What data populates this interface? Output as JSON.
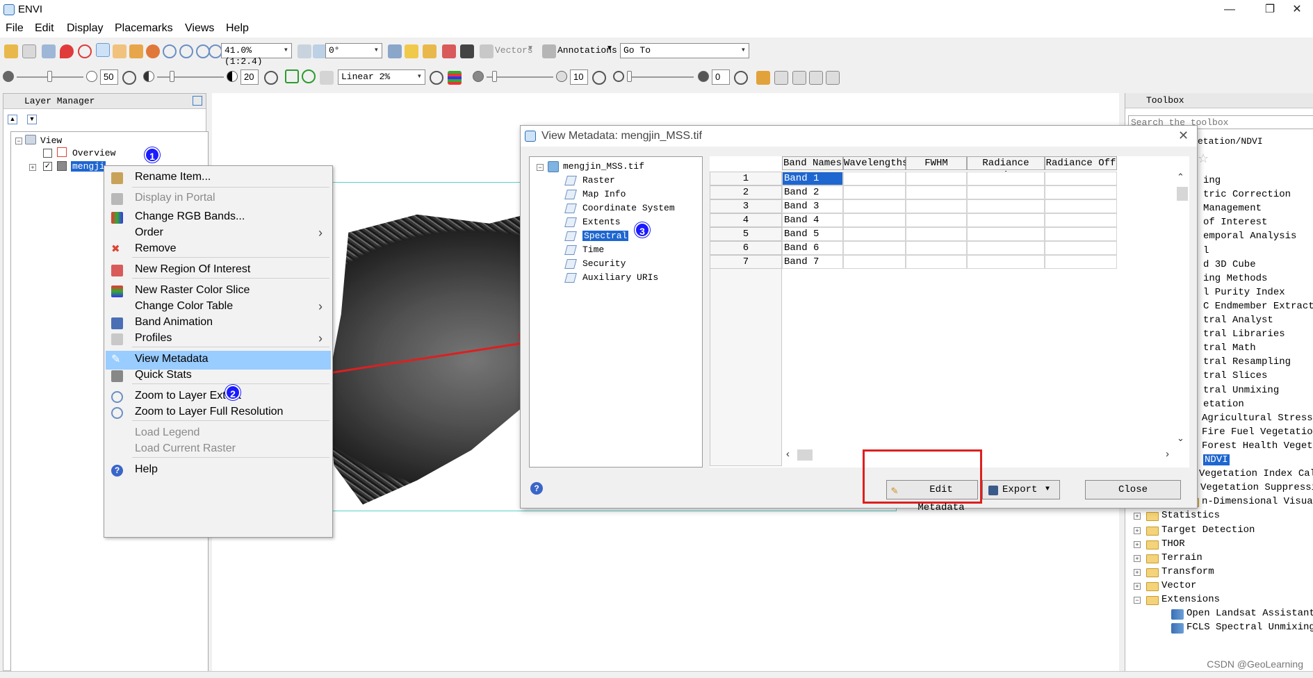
{
  "window": {
    "title": "ENVI",
    "minimize": "—",
    "restore": "❐",
    "close": "✕"
  },
  "menu": [
    "File",
    "Edit",
    "Display",
    "Placemarks",
    "Views",
    "Help"
  ],
  "toolbar1": {
    "zoom": "41.0% (1:2.4)",
    "rotation": "0°",
    "vectors": "Vectors",
    "annotations": "Annotations",
    "goto": "Go To"
  },
  "toolbar2": {
    "brightness": "50",
    "contrast": "20",
    "stretch": "Linear 2%",
    "sharpen": "10",
    "transparency": "0"
  },
  "layer_manager": {
    "title": "Layer Manager",
    "tree": [
      "View",
      "Overview",
      "mengjin_MSS.tif"
    ]
  },
  "context_menu": {
    "items": [
      {
        "label": "Rename Item...",
        "icon": "rename-icon",
        "disabled": false
      },
      {
        "label": "Display in Portal",
        "icon": "portal-icon",
        "disabled": true
      },
      {
        "label": "Change RGB Bands...",
        "icon": "rgb-icon",
        "disabled": false
      },
      {
        "label": "Order",
        "icon": "",
        "disabled": false,
        "submenu": true
      },
      {
        "label": "Remove",
        "icon": "remove-icon",
        "disabled": false
      },
      {
        "label": "New Region Of Interest",
        "icon": "roi-icon",
        "disabled": false
      },
      {
        "label": "New Raster Color Slice",
        "icon": "color-slice-icon",
        "disabled": false
      },
      {
        "label": "Change Color Table",
        "icon": "",
        "disabled": false,
        "submenu": true
      },
      {
        "label": "Band Animation",
        "icon": "animation-icon",
        "disabled": false
      },
      {
        "label": "Profiles",
        "icon": "profiles-icon",
        "disabled": false,
        "submenu": true
      },
      {
        "label": "View Metadata",
        "icon": "metadata-icon",
        "disabled": false,
        "selected": true
      },
      {
        "label": "Quick Stats",
        "icon": "stats-icon",
        "disabled": false
      },
      {
        "label": "Zoom to Layer Extent",
        "icon": "zoom-extent-icon",
        "disabled": false
      },
      {
        "label": "Zoom to Layer Full Resolution",
        "icon": "zoom-full-icon",
        "disabled": false
      },
      {
        "label": "Load Legend",
        "icon": "",
        "disabled": true
      },
      {
        "label": "Load Current Raster",
        "icon": "",
        "disabled": true
      },
      {
        "label": "Help",
        "icon": "help-icon",
        "disabled": false
      }
    ]
  },
  "badges": [
    "1",
    "2",
    "3"
  ],
  "metadata_dialog": {
    "title": "View Metadata: mengjin_MSS.tif",
    "tree_root": "mengjin_MSS.tif",
    "tree_items": [
      "Raster",
      "Map Info",
      "Coordinate System",
      "Extents",
      "Spectral",
      "Time",
      "Security",
      "Auxiliary URIs"
    ],
    "columns": [
      "Band Names",
      "Wavelengths",
      "FWHM",
      "Radiance Gains",
      "Radiance Off"
    ],
    "rows": [
      {
        "num": "1",
        "band": "Band 1"
      },
      {
        "num": "2",
        "band": "Band 2"
      },
      {
        "num": "3",
        "band": "Band 3"
      },
      {
        "num": "4",
        "band": "Band 4"
      },
      {
        "num": "5",
        "band": "Band 5"
      },
      {
        "num": "6",
        "band": "Band 6"
      },
      {
        "num": "7",
        "band": "Band 7"
      }
    ],
    "edit_button": "Edit Metadata",
    "export_button": "Export",
    "close_button": "Close"
  },
  "toolbox": {
    "title": "Toolbox",
    "search_placeholder": "Search the toolbox",
    "path": "etation/NDVI",
    "items": [
      {
        "label": "ing",
        "indent": 2,
        "kind": "text"
      },
      {
        "label": "tric Correction",
        "indent": 2,
        "kind": "text"
      },
      {
        "label": "Management",
        "indent": 2,
        "kind": "text"
      },
      {
        "label": "of Interest",
        "indent": 2,
        "kind": "text"
      },
      {
        "label": "emporal Analysis",
        "indent": 2,
        "kind": "text"
      },
      {
        "label": "l",
        "indent": 2,
        "kind": "text"
      },
      {
        "label": "d 3D Cube",
        "indent": 2,
        "kind": "text"
      },
      {
        "label": "ing Methods",
        "indent": 2,
        "kind": "text"
      },
      {
        "label": "l Purity Index",
        "indent": 2,
        "kind": "text"
      },
      {
        "label": "C Endmember Extraction",
        "indent": 2,
        "kind": "text"
      },
      {
        "label": "tral Analyst",
        "indent": 2,
        "kind": "text"
      },
      {
        "label": "tral Libraries",
        "indent": 2,
        "kind": "text"
      },
      {
        "label": "tral Math",
        "indent": 2,
        "kind": "text"
      },
      {
        "label": "tral Resampling",
        "indent": 2,
        "kind": "text"
      },
      {
        "label": "tral Slices",
        "indent": 2,
        "kind": "text"
      },
      {
        "label": "tral Unmixing",
        "indent": 2,
        "kind": "text"
      },
      {
        "label": "etation",
        "indent": 2,
        "kind": "text"
      },
      {
        "label": "Agricultural Stress Ve",
        "indent": 2,
        "kind": "text"
      },
      {
        "label": "Fire Fuel Vegetation A",
        "indent": 2,
        "kind": "text"
      },
      {
        "label": "Forest Health Vegetati",
        "indent": 2,
        "kind": "text"
      },
      {
        "label": "NDVI",
        "indent": 2,
        "kind": "selected"
      },
      {
        "label": "Vegetation Index Calcu",
        "indent": 2,
        "kind": "text"
      },
      {
        "label": "Vegetation Suppression",
        "indent": 2,
        "kind": "tool"
      },
      {
        "label": "n-Dimensional Visualizer",
        "indent": 1,
        "kind": "folder"
      },
      {
        "label": "Statistics",
        "indent": 0,
        "kind": "folder"
      },
      {
        "label": "Target Detection",
        "indent": 0,
        "kind": "folder"
      },
      {
        "label": "THOR",
        "indent": 0,
        "kind": "folder"
      },
      {
        "label": "Terrain",
        "indent": 0,
        "kind": "folder"
      },
      {
        "label": "Transform",
        "indent": 0,
        "kind": "folder"
      },
      {
        "label": "Vector",
        "indent": 0,
        "kind": "folder"
      },
      {
        "label": "Extensions",
        "indent": 0,
        "kind": "folder-open"
      },
      {
        "label": "Open Landsat Assistant",
        "indent": 1,
        "kind": "tool"
      },
      {
        "label": "FCLS Spectral Unmixing",
        "indent": 1,
        "kind": "tool"
      }
    ]
  },
  "watermark": "CSDN @GeoLearning",
  "colors": {
    "selection": "#99ccff",
    "badge": "#1a1aff",
    "highlight_box": "#dd1f1f",
    "arrow": "#dd1f1f"
  }
}
